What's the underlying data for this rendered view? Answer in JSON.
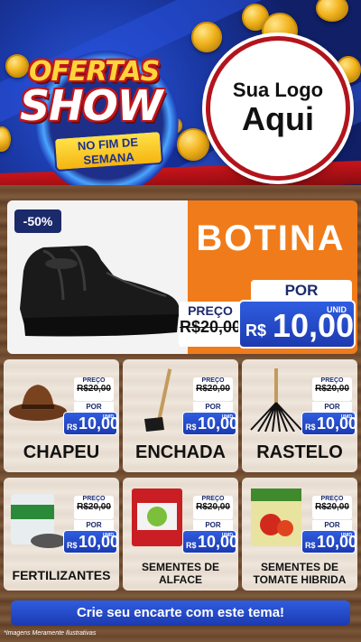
{
  "header": {
    "title_line1": "OFERTAS",
    "title_line2": "SHOW",
    "subtitle": "NO FIM DE SEMANA",
    "logo_line1": "Sua Logo",
    "logo_line2": "Aqui"
  },
  "featured": {
    "discount": "-50%",
    "name": "BOTINA",
    "price_label": "PREÇO",
    "old_price": "R$20,00",
    "por_label": "POR",
    "currency": "R$",
    "new_price": "10,00",
    "unit": "UNID"
  },
  "products": [
    {
      "name": "CHAPEU",
      "icon": "hat-icon",
      "price_label": "PREÇO",
      "old_price": "R$20,00",
      "por_label": "POR",
      "currency": "R$",
      "new_price": "10,00",
      "unit": "UNID"
    },
    {
      "name": "ENCHADA",
      "icon": "hoe-icon",
      "price_label": "PREÇO",
      "old_price": "R$20,00",
      "por_label": "POR",
      "currency": "R$",
      "new_price": "10,00",
      "unit": "UNID"
    },
    {
      "name": "RASTELO",
      "icon": "rake-icon",
      "price_label": "PREÇO",
      "old_price": "R$20,00",
      "por_label": "POR",
      "currency": "R$",
      "new_price": "10,00",
      "unit": "UNID"
    },
    {
      "name": "FERTILIZANTES",
      "icon": "fertilizer-icon",
      "price_label": "PREÇO",
      "old_price": "R$20,00",
      "por_label": "POR",
      "currency": "R$",
      "new_price": "10,00",
      "unit": "UNID"
    },
    {
      "name": "SEMENTES DE ALFACE",
      "icon": "seed-packet-icon",
      "price_label": "PREÇO",
      "old_price": "R$20,00",
      "por_label": "POR",
      "currency": "R$",
      "new_price": "10,00",
      "unit": "UNID"
    },
    {
      "name": "SEMENTES DE TOMATE HIBRIDA",
      "icon": "tomato-seed-icon",
      "price_label": "PREÇO",
      "old_price": "R$20,00",
      "por_label": "POR",
      "currency": "R$",
      "new_price": "10,00",
      "unit": "UNID"
    }
  ],
  "cta": "Crie seu encarte com este tema!",
  "disclaimer": "*Imagens Meramente Ilustrativas",
  "colors": {
    "accent_blue": "#1c3ab0",
    "orange": "#f07b1a",
    "brand_red": "#c0161c",
    "gold": "#f5b40f"
  }
}
